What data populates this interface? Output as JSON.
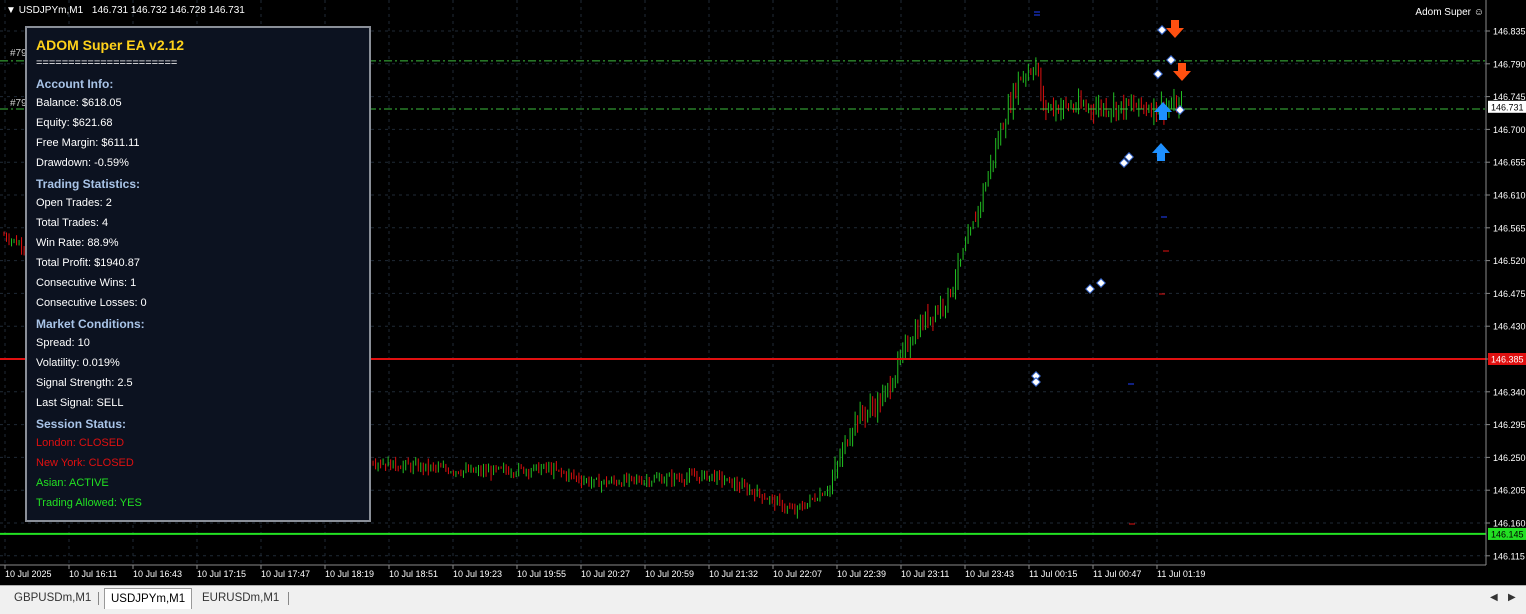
{
  "chart_header": {
    "symbol": "USDJPYm,M1",
    "ohlc": "146.731 146.732 146.728 146.731",
    "indicator": "Adom Super"
  },
  "panel": {
    "title": "ADOM Super EA v2.12",
    "separator": "======================",
    "account_header": "Account Info:",
    "balance": "Balance: $618.05",
    "equity": "Equity: $621.68",
    "free_margin": "Free Margin: $611.11",
    "drawdown": "Drawdown: -0.59%",
    "stats_header": "Trading Statistics:",
    "open_trades": "Open Trades: 2",
    "total_trades": "Total Trades: 4",
    "win_rate": "Win Rate: 88.9%",
    "total_profit": "Total Profit: $1940.87",
    "cons_wins": "Consecutive Wins: 1",
    "cons_losses": "Consecutive Losses: 0",
    "market_header": "Market Conditions:",
    "spread": "Spread: 10",
    "volatility": "Volatility: 0.019%",
    "signal_strength": "Signal Strength: 2.5",
    "last_signal": "Last Signal: SELL",
    "session_header": "Session Status:",
    "london": "London: CLOSED",
    "newyork": "New York: CLOSED",
    "asian": "Asian: ACTIVE",
    "trading_allowed": "Trading Allowed: YES"
  },
  "order_labels": [
    "#79",
    "#79"
  ],
  "price_tags": {
    "current": "146.731",
    "red_line": "146.385",
    "green_line": "146.145"
  },
  "colors": {
    "background": "#000000",
    "bull": "#22c022",
    "bear": "#e01010",
    "grid": "#1f2a36",
    "panel_bg": "#0c1220",
    "red_line": "#e01010",
    "green_line": "#22e022",
    "sell_arrow": "#ff5010",
    "buy_arrow": "#1e90ff"
  },
  "tabs": [
    "GBPUSDm,M1",
    "USDJPYm,M1",
    "EURUSDm,M1"
  ],
  "active_tab": "USDJPYm,M1",
  "chart_data": {
    "type": "candlestick",
    "y_ticks": [
      "146.835",
      "146.790",
      "146.745",
      "146.700",
      "146.655",
      "146.610",
      "146.565",
      "146.520",
      "146.475",
      "146.430",
      "146.385",
      "146.340",
      "146.295",
      "146.250",
      "146.205",
      "146.160",
      "146.115"
    ],
    "ylim": [
      146.115,
      146.835
    ],
    "x_ticks": [
      "10 Jul 2025",
      "10 Jul 16:11",
      "10 Jul 16:43",
      "10 Jul 17:15",
      "10 Jul 17:47",
      "10 Jul 18:19",
      "10 Jul 18:51",
      "10 Jul 19:23",
      "10 Jul 19:55",
      "10 Jul 20:27",
      "10 Jul 20:59",
      "10 Jul 21:32",
      "10 Jul 22:07",
      "10 Jul 22:39",
      "10 Jul 23:11",
      "10 Jul 23:43",
      "11 Jul 00:15",
      "11 Jul 00:47",
      "11 Jul 01:19"
    ],
    "levels": {
      "entry_1": 146.794,
      "entry_2": 146.728,
      "red_line": 146.385,
      "green_line": 146.145
    },
    "close_path": [
      [
        0,
        146.555
      ],
      [
        0.05,
        146.51
      ],
      [
        0.2,
        146.35
      ],
      [
        0.26,
        146.262
      ],
      [
        0.33,
        146.24
      ],
      [
        0.4,
        146.23
      ],
      [
        0.46,
        146.235
      ],
      [
        0.5,
        146.215
      ],
      [
        0.55,
        146.22
      ],
      [
        0.6,
        146.225
      ],
      [
        0.64,
        146.2
      ],
      [
        0.67,
        146.175
      ],
      [
        0.7,
        146.21
      ],
      [
        0.72,
        146.3
      ],
      [
        0.745,
        146.33
      ],
      [
        0.77,
        146.42
      ],
      [
        0.8,
        146.47
      ],
      [
        0.82,
        146.56
      ],
      [
        0.845,
        146.7
      ],
      [
        0.86,
        146.77
      ],
      [
        0.875,
        146.79
      ],
      [
        0.88,
        146.731
      ]
    ]
  }
}
